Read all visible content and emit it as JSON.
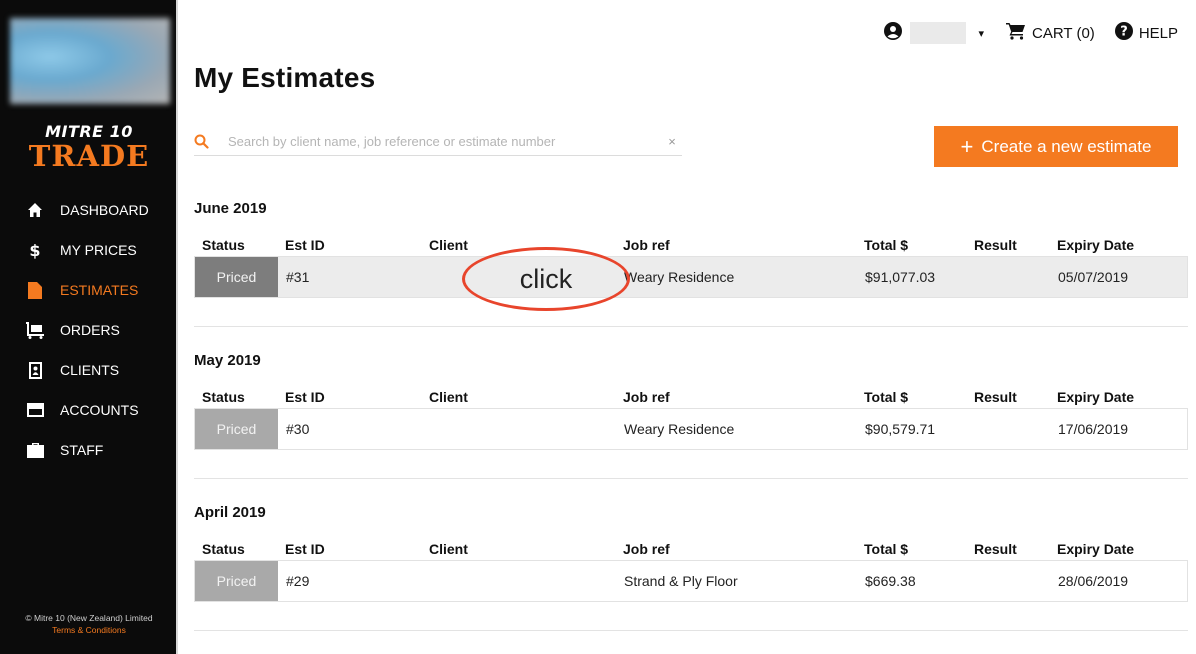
{
  "brand": {
    "top": "MITRE 10",
    "main": "TRADE"
  },
  "sidebar": {
    "items": [
      {
        "label": "DASHBOARD",
        "icon": "home-icon",
        "active": false
      },
      {
        "label": "MY PRICES",
        "icon": "dollar-icon",
        "active": false
      },
      {
        "label": "ESTIMATES",
        "icon": "document-icon",
        "active": true
      },
      {
        "label": "ORDERS",
        "icon": "trolley-icon",
        "active": false
      },
      {
        "label": "CLIENTS",
        "icon": "contact-icon",
        "active": false
      },
      {
        "label": "ACCOUNTS",
        "icon": "card-icon",
        "active": false
      },
      {
        "label": "STAFF",
        "icon": "briefcase-icon",
        "active": false
      }
    ],
    "footer": {
      "copyright": "© Mitre 10 (New Zealand) Limited",
      "terms": "Terms & Conditions"
    }
  },
  "topbar": {
    "caret": "▾",
    "cart_label": "CART (0)",
    "help_label": "HELP"
  },
  "page_title": "My Estimates",
  "search": {
    "placeholder": "Search by client name, job reference or estimate number",
    "value": "",
    "clear": "×"
  },
  "create_button": {
    "plus": "+",
    "label": "Create a new estimate"
  },
  "columns": {
    "status": "Status",
    "est_id": "Est ID",
    "client": "Client",
    "job_ref": "Job ref",
    "total": "Total $",
    "result": "Result",
    "expiry": "Expiry Date"
  },
  "groups": [
    {
      "month": "June 2019",
      "rows": [
        {
          "status": "Priced",
          "est_id": "#31",
          "client": "",
          "job_ref": "Weary Residence",
          "total": "$91,077.03",
          "result": "",
          "expiry": "05/07/2019"
        }
      ]
    },
    {
      "month": "May 2019",
      "rows": [
        {
          "status": "Priced",
          "est_id": "#30",
          "client": "",
          "job_ref": "Weary Residence",
          "total": "$90,579.71",
          "result": "",
          "expiry": "17/06/2019"
        }
      ]
    },
    {
      "month": "April 2019",
      "rows": [
        {
          "status": "Priced",
          "est_id": "#29",
          "client": "",
          "job_ref": "Strand & Ply Floor",
          "total": "$669.38",
          "result": "",
          "expiry": "28/06/2019"
        }
      ]
    }
  ],
  "annotation": {
    "label": "click"
  },
  "colors": {
    "accent": "#f47a20",
    "sidebar_bg": "#0b0b0b",
    "annotation": "#e8452c"
  }
}
